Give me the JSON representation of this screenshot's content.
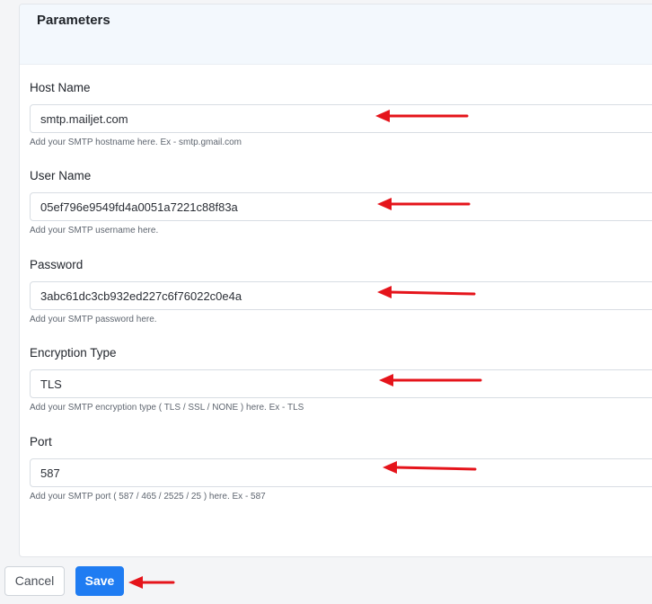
{
  "panel": {
    "title": "Parameters"
  },
  "fields": [
    {
      "label": "Host Name",
      "value": "smtp.mailjet.com",
      "help": "Add your SMTP hostname here. Ex - smtp.gmail.com"
    },
    {
      "label": "User Name",
      "value": "05ef796e9549fd4a0051a7221c88f83a",
      "help": "Add your SMTP username here."
    },
    {
      "label": "Password",
      "value": "3abc61dc3cb932ed227c6f76022c0e4a",
      "help": "Add your SMTP password here."
    },
    {
      "label": "Encryption Type",
      "value": "TLS",
      "help": "Add your SMTP encryption type ( TLS / SSL / NONE ) here. Ex - TLS"
    },
    {
      "label": "Port",
      "value": "587",
      "help": "Add your SMTP port ( 587 / 465 / 2525 / 25 ) here. Ex - 587"
    }
  ],
  "actions": {
    "cancel_label": "Cancel",
    "save_label": "Save"
  },
  "colors": {
    "annotation_arrow": "#e5141b",
    "primary": "#1f7cf2"
  }
}
